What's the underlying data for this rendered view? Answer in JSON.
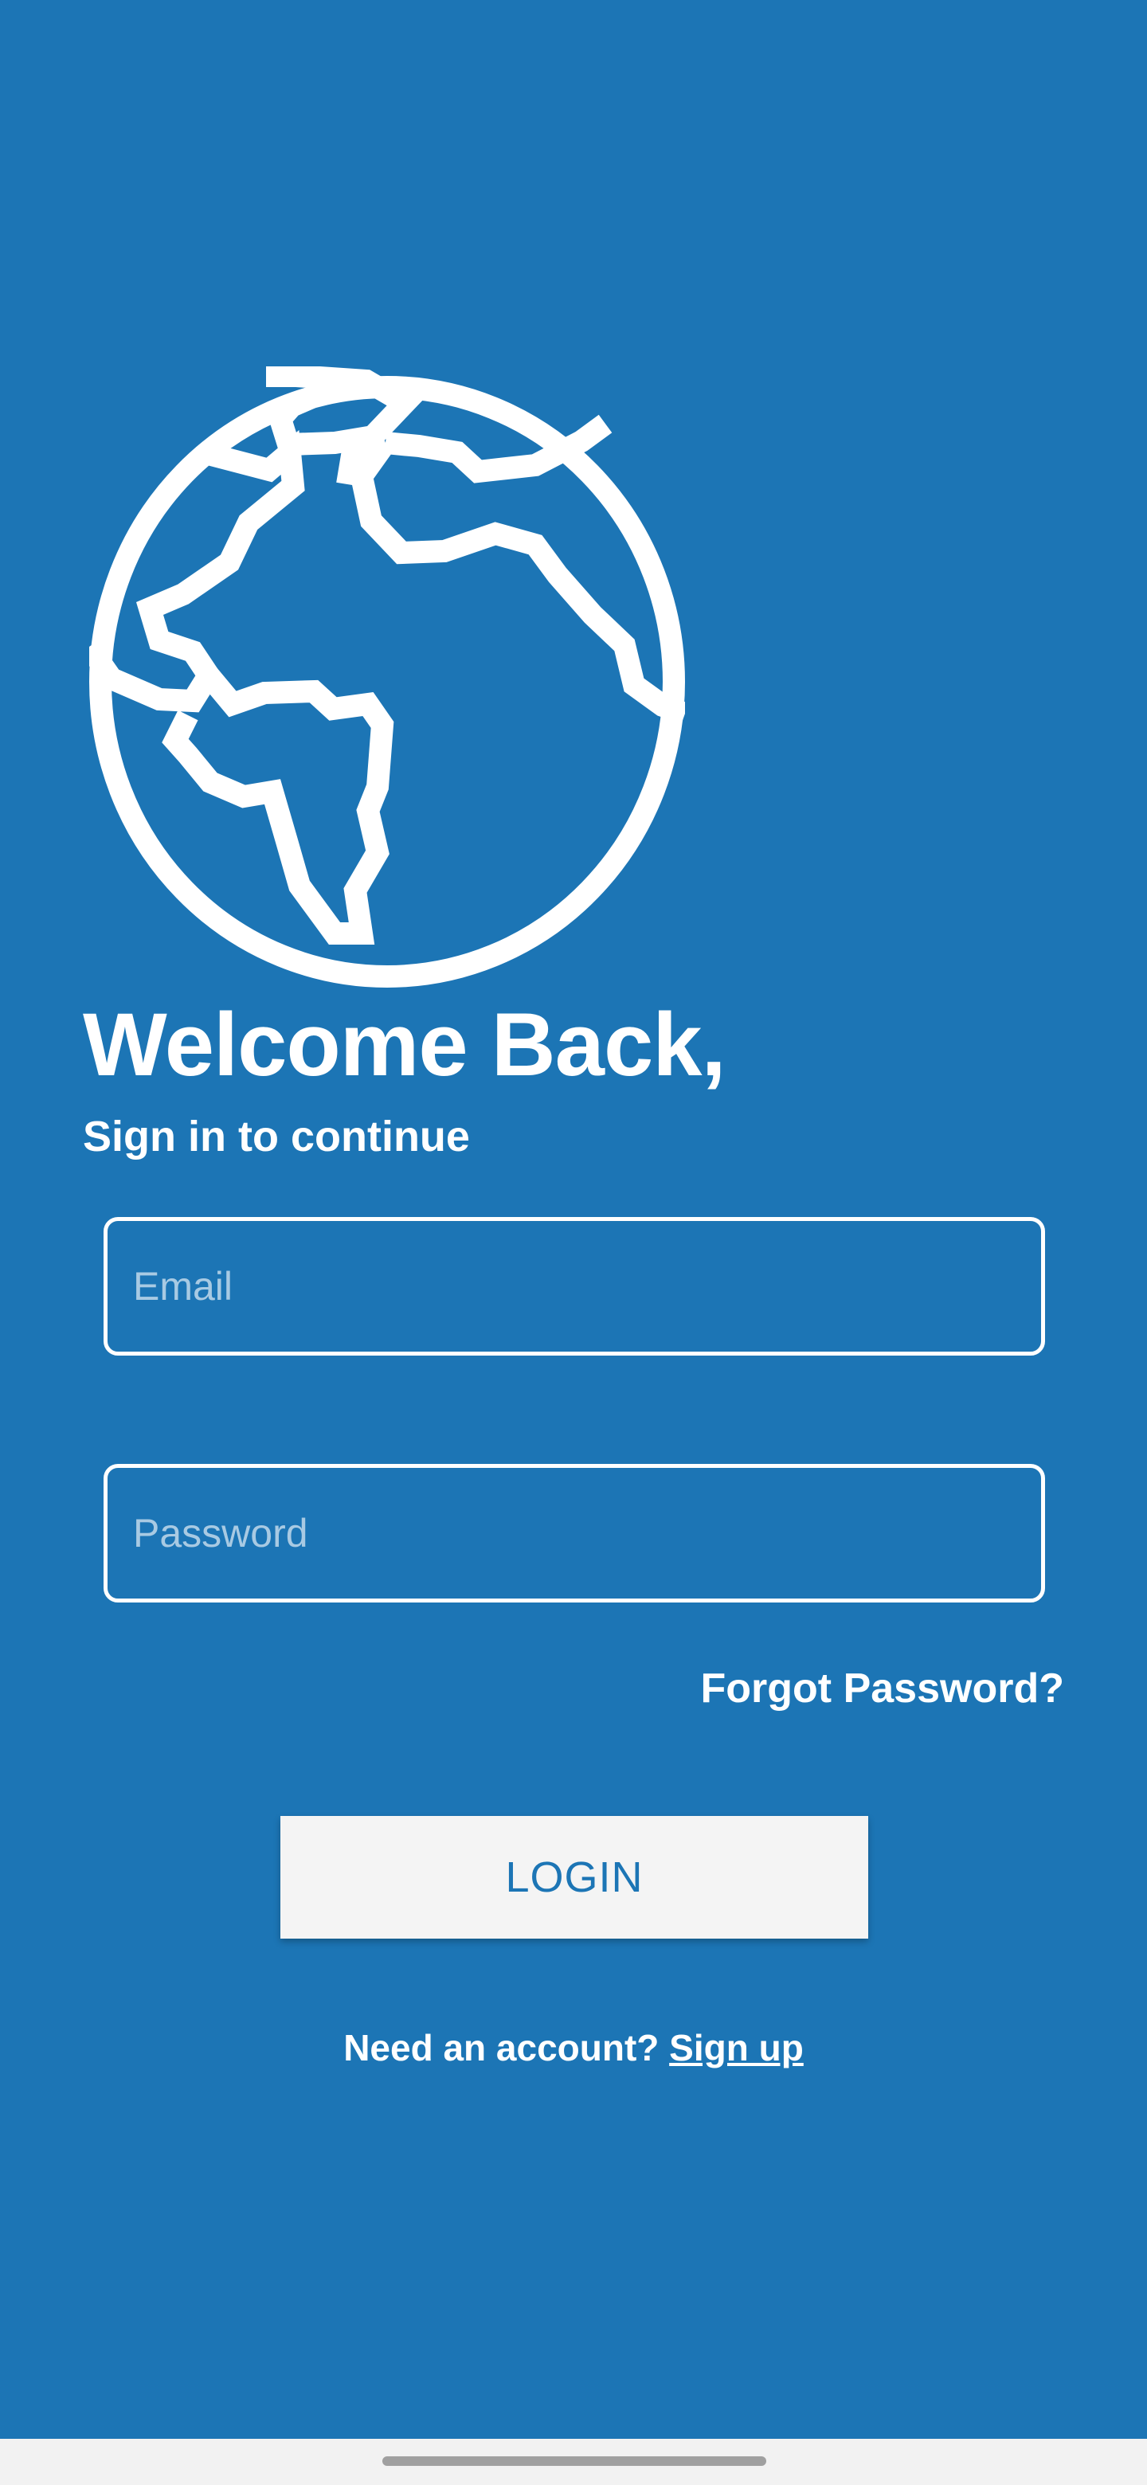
{
  "colors": {
    "background": "#1c75b5",
    "foreground": "#ffffff",
    "button_background": "#f4f4f4",
    "button_text": "#1c75b5",
    "navbar_background": "#f2f2f2",
    "home_indicator": "#a0a0a0"
  },
  "hero": {
    "icon": "globe-icon",
    "title": "Welcome Back,",
    "subtitle": "Sign in to continue"
  },
  "form": {
    "email": {
      "value": "",
      "placeholder": "Email"
    },
    "password": {
      "value": "",
      "placeholder": "Password"
    },
    "forgot_label": "Forgot Password?",
    "login_label": "LOGIN"
  },
  "footer": {
    "prompt": "Need an account?",
    "signup_label": "Sign up"
  }
}
